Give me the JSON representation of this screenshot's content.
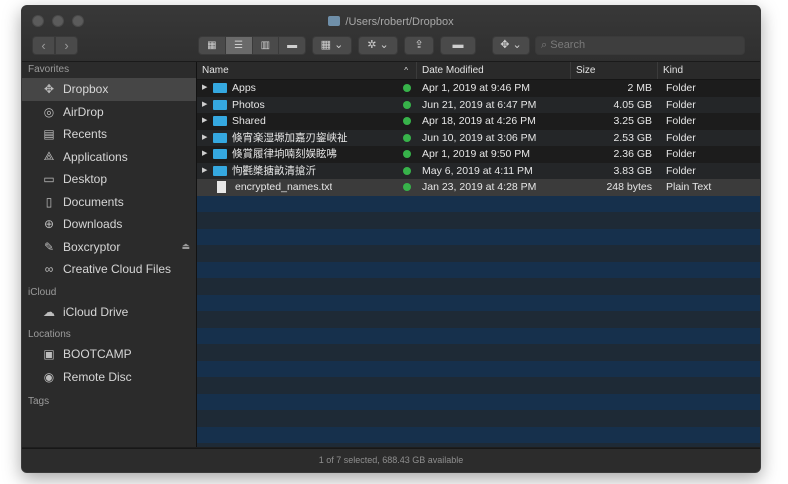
{
  "window": {
    "title": "/Users/robert/Dropbox",
    "status": "1 of 7 selected, 688.43 GB available"
  },
  "toolbar": {
    "back": "‹",
    "forward": "›",
    "search_placeholder": "Search"
  },
  "sidebar": {
    "favorites_label": "Favorites",
    "favorites": [
      {
        "label": "Dropbox",
        "icon": "dropbox-icon"
      },
      {
        "label": "AirDrop",
        "icon": "airdrop-icon"
      },
      {
        "label": "Recents",
        "icon": "recents-icon"
      },
      {
        "label": "Applications",
        "icon": "applications-icon"
      },
      {
        "label": "Desktop",
        "icon": "desktop-icon"
      },
      {
        "label": "Documents",
        "icon": "documents-icon"
      },
      {
        "label": "Downloads",
        "icon": "downloads-icon"
      },
      {
        "label": "Boxcryptor",
        "icon": "boxcryptor-icon"
      },
      {
        "label": "Creative Cloud Files",
        "icon": "creative-cloud-icon"
      }
    ],
    "icloud_label": "iCloud",
    "icloud": [
      {
        "label": "iCloud Drive",
        "icon": "cloud-icon"
      }
    ],
    "locations_label": "Locations",
    "locations": [
      {
        "label": "BOOTCAMP",
        "icon": "disk-icon"
      },
      {
        "label": "Remote Disc",
        "icon": "disc-icon"
      }
    ],
    "tags_label": "Tags"
  },
  "list": {
    "columns": {
      "name": "Name",
      "date": "Date Modified",
      "size": "Size",
      "kind": "Kind"
    },
    "rows": [
      {
        "name": "Apps",
        "date": "Apr 1, 2019 at 9:46 PM",
        "size": "2 MB",
        "kind": "Folder",
        "type": "folder"
      },
      {
        "name": "Photos",
        "date": "Jun 21, 2019 at 6:47 PM",
        "size": "4.05 GB",
        "kind": "Folder",
        "type": "folder"
      },
      {
        "name": "Shared",
        "date": "Apr 18, 2019 at 4:26 PM",
        "size": "3.25 GB",
        "kind": "Folder",
        "type": "folder"
      },
      {
        "name": "倏宵楽湿塬加嘉刃鋆峡祉",
        "date": "Jun 10, 2019 at 3:06 PM",
        "size": "2.53 GB",
        "kind": "Folder",
        "type": "folder"
      },
      {
        "name": "倏賞履律垧喃刻娱眩咈",
        "date": "Apr 1, 2019 at 9:50 PM",
        "size": "2.36 GB",
        "kind": "Folder",
        "type": "folder"
      },
      {
        "name": "怐氍槳搪畝清搶沂",
        "date": "May 6, 2019 at 4:11 PM",
        "size": "3.83 GB",
        "kind": "Folder",
        "type": "folder"
      },
      {
        "name": "encrypted_names.txt",
        "date": "Jan 23, 2019 at 4:28 PM",
        "size": "248 bytes",
        "kind": "Plain Text",
        "type": "file"
      }
    ]
  }
}
